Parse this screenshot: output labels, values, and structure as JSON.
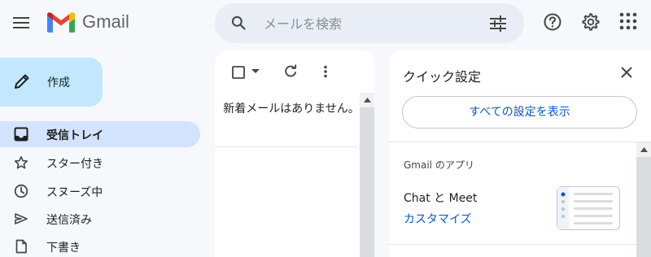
{
  "app": {
    "name": "Gmail"
  },
  "search": {
    "placeholder": "メールを検索"
  },
  "sidebar": {
    "compose_label": "作成",
    "items": [
      {
        "label": "受信トレイ",
        "icon": "inbox-icon",
        "active": true
      },
      {
        "label": "スター付き",
        "icon": "star-icon"
      },
      {
        "label": "スヌーズ中",
        "icon": "clock-icon"
      },
      {
        "label": "送信済み",
        "icon": "send-icon"
      },
      {
        "label": "下書き",
        "icon": "draft-icon"
      }
    ]
  },
  "mail_list": {
    "empty_message": "新着メールはありません。"
  },
  "quick_settings": {
    "title": "クイック設定",
    "all_settings_label": "すべての設定を表示",
    "apps_section": "Gmail のアプリ",
    "chat_meet_label": "Chat と Meet",
    "customize_label": "カスタマイズ"
  },
  "colors": {
    "background": "#f6f8fc",
    "compose": "#c2e7ff",
    "active_nav": "#d3e3fd",
    "link": "#0b57d0",
    "search_bg": "#e9eef6"
  }
}
